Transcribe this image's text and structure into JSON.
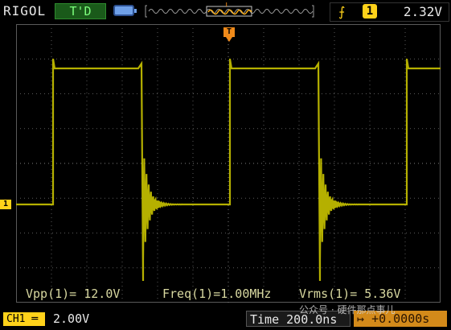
{
  "header": {
    "brand": "RIGOL",
    "run_status": "T'D",
    "memory_icon": "memory-depth-icon",
    "trigger_position_marker": "T",
    "trigger": {
      "edge_icon": "rising-edge-icon",
      "source": "1",
      "level": "2.32V"
    }
  },
  "screen": {
    "grid": true,
    "trigger_marker": "T",
    "channel_marker": "1",
    "trace_color": "#b5b000",
    "waveform": {
      "type": "square",
      "frequency": "1.00MHz",
      "vpp_volts": 12.0
    }
  },
  "measurements": {
    "vpp": "Vpp(1)= 12.0V",
    "freq": "Freq(1)=1.00MHz",
    "vrms": "Vrms(1)= 5.36V"
  },
  "footer": {
    "channel": "CH1",
    "channel_coupling_icon": "dc-coupling-icon",
    "volts_div": "2.00V",
    "time_div": "Time 200.0ns",
    "trigger_offset_icon": "trigger-offset-icon",
    "trigger_offset": "+0.0000s"
  },
  "watermark": "公众号 · 硬件那点事儿",
  "colors": {
    "channel1": "#ffd21a",
    "trigger": "#f08a1a",
    "grid": "#5a5a5a"
  }
}
